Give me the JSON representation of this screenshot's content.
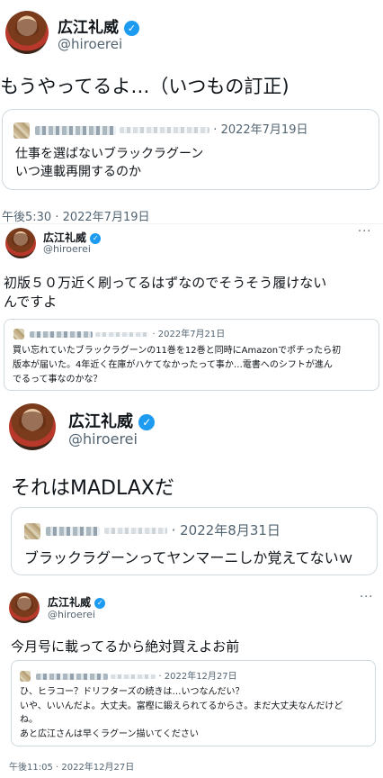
{
  "tweets": [
    {
      "author": {
        "name": "広江礼威",
        "handle": "@hiroerei",
        "verified_icon": "verified-badge-icon"
      },
      "text": "もうやってるよ…（いつもの訂正)",
      "quote": {
        "date": "2022年7月19日",
        "lines": [
          "仕事を選ばないブラックラグーン",
          "いつ連載再開するのか"
        ]
      },
      "timestamp": "午後5:30 · 2022年7月19日"
    },
    {
      "author": {
        "name": "広江礼威",
        "handle": "@hiroerei",
        "verified_icon": "verified-badge-icon"
      },
      "more_icon": "more-options-icon",
      "text_lines": [
        "初版５０万近く刷ってるはずなのでそうそう履けない",
        "んですよ"
      ],
      "quote": {
        "date": "2022年7月21日",
        "lines": [
          "買い忘れていたブラックラグーンの11巻を12巻と同時にAmazonでポチったら初",
          "版本が届いた。4年近く在庫がハケてなかったって事か…電書へのシフトが進ん",
          "でるって事なのかな？"
        ]
      }
    },
    {
      "author": {
        "name": "広江礼威",
        "handle": "@hiroerei",
        "verified_icon": "verified-badge-icon"
      },
      "text": "それはMADLAXだ",
      "quote": {
        "date": "2022年8月31日",
        "lines": [
          "ブラックラグーンってヤンマーニしか覚えてないｗ"
        ]
      }
    },
    {
      "author": {
        "name": "広江礼威",
        "handle": "@hiroerei",
        "verified_icon": "verified-badge-icon"
      },
      "more_icon": "more-options-icon",
      "text": "今月号に載ってるから絶対買えよお前",
      "quote": {
        "date": "2022年12月27日",
        "lines": [
          "ひ、ヒラコー？ドリフターズの続きは…いつなんだい？",
          "いや、いいんだよ。大丈夫。富樫に鍛えられてるからさ。まだ大丈夫なんだけど",
          "ね。",
          "あと広江さんは早くラグーン描いてください"
        ]
      },
      "timestamp": "午後11:05 · 2022年12月27日"
    }
  ],
  "ui": {
    "more_glyph": "···",
    "badge_glyph": "✓",
    "dot": "·"
  }
}
